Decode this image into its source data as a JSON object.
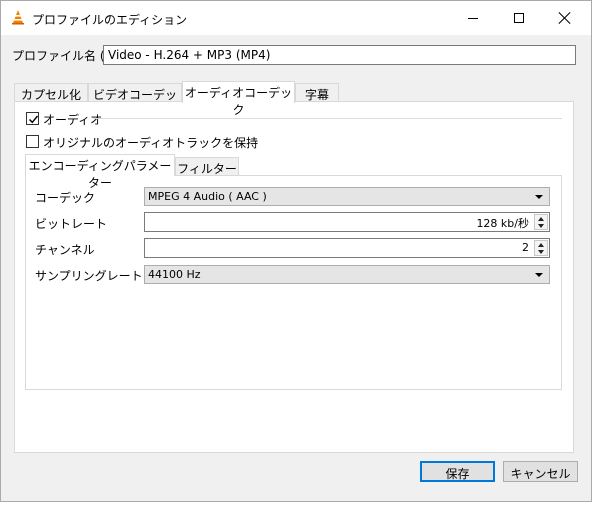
{
  "window": {
    "title": "プロファイルのエディション",
    "app_icon": "vlc-cone-icon",
    "controls": [
      "minimize-icon",
      "maximize-icon",
      "close-icon"
    ]
  },
  "profile": {
    "label": "プロファイル名 (N)",
    "value": "Video - H.264 + MP3 (MP4)"
  },
  "tabs": [
    {
      "label": "カプセル化",
      "active": false
    },
    {
      "label": "ビデオコーデック",
      "active": false
    },
    {
      "label": "オーディオコーデック",
      "active": true
    },
    {
      "label": "字幕",
      "active": false
    }
  ],
  "audio": {
    "enable_label": "オーディオ",
    "enable_checked": true,
    "keep_label": "オリジナルのオーディオトラックを保持",
    "keep_checked": false
  },
  "subtabs": [
    {
      "label": "エンコーディングパラメーター",
      "active": true
    },
    {
      "label": "フィルター",
      "active": false
    }
  ],
  "params": {
    "codec_label": "コーデック",
    "codec_value": "MPEG 4 Audio ( AAC )",
    "bitrate_label": "ビットレート",
    "bitrate_value": "128 kb/秒",
    "channels_label": "チャンネル",
    "channels_value": "2",
    "samplerate_label": "サンプリングレート (m)",
    "samplerate_value": "44100 Hz"
  },
  "buttons": {
    "save": "保存",
    "cancel": "キャンセル"
  },
  "colors": {
    "accent": "#0078d7",
    "vlc_orange": "#f08000"
  }
}
